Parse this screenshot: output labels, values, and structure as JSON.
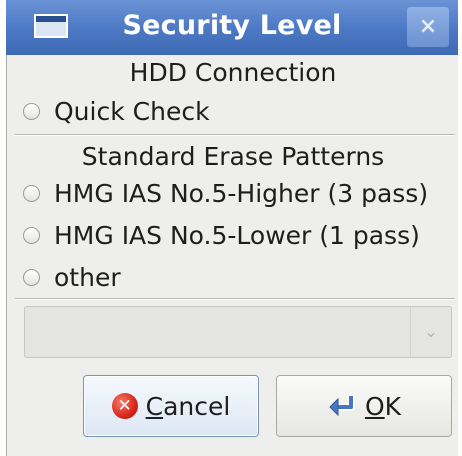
{
  "dialog": {
    "title": "Security Level",
    "close_glyph": "×"
  },
  "hdd_section": {
    "heading": "HDD Connection",
    "options": [
      {
        "label": "Quick Check",
        "selected": false
      }
    ]
  },
  "erase_section": {
    "heading": "Standard Erase Patterns",
    "options": [
      {
        "label": "HMG IAS No.5-Higher (3 pass)",
        "selected": false
      },
      {
        "label": "HMG IAS No.5-Lower (1 pass)",
        "selected": false
      },
      {
        "label": "other",
        "selected": false
      }
    ]
  },
  "combo": {
    "value": "",
    "arrow_glyph": "⌄",
    "enabled": false
  },
  "buttons": {
    "cancel": {
      "mnemonic": "C",
      "rest": "ancel",
      "icon": "cancel-icon",
      "icon_glyph": "✕"
    },
    "ok": {
      "mnemonic": "O",
      "rest": "K",
      "icon": "ok-enter-icon"
    }
  }
}
